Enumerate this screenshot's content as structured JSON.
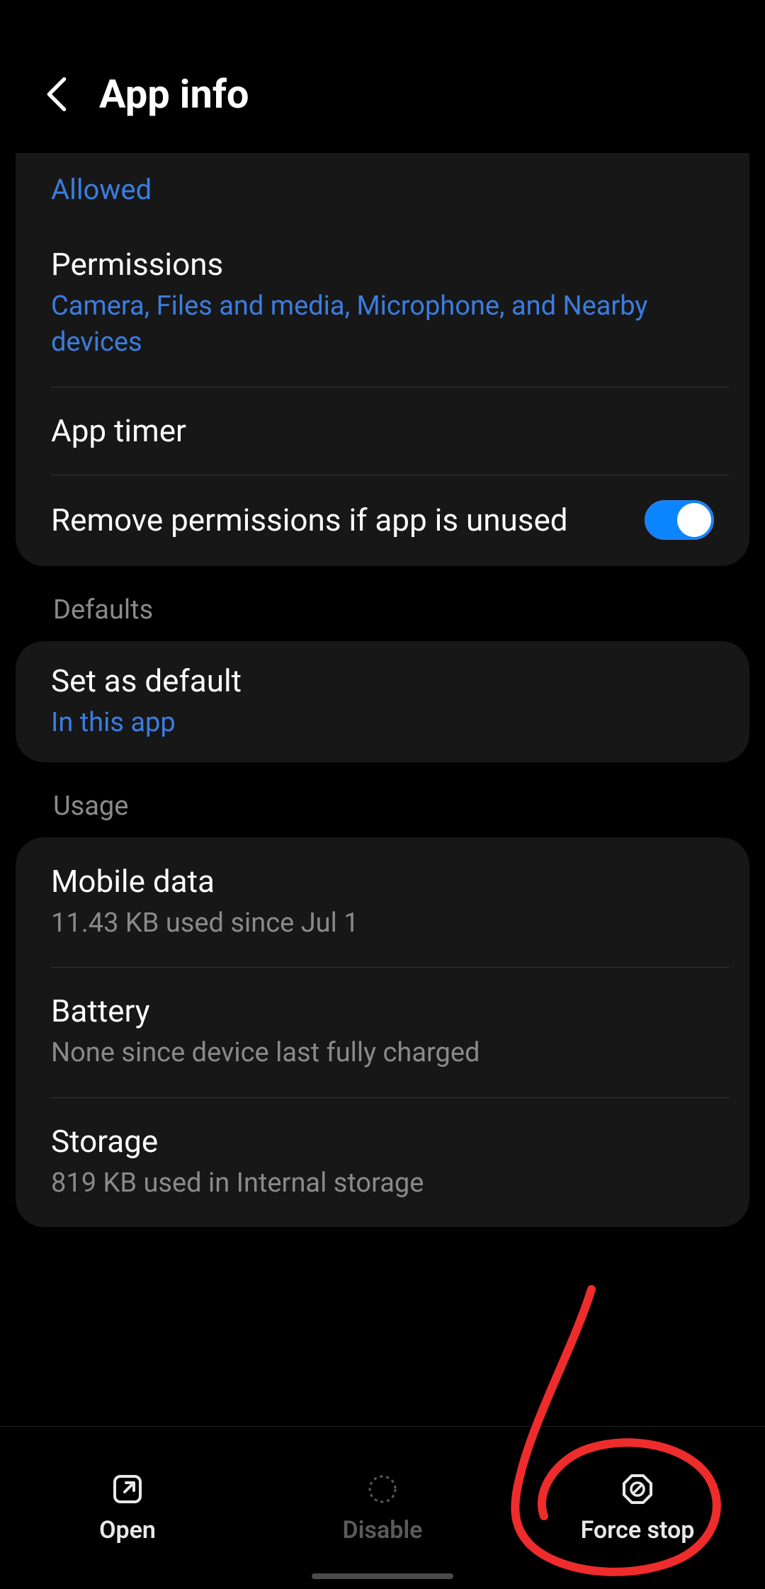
{
  "header": {
    "title": "App info"
  },
  "top_card": {
    "allowed_label": "Allowed",
    "permissions": {
      "title": "Permissions",
      "subtitle": "Camera, Files and media, Microphone, and Nearby devices"
    },
    "app_timer": {
      "title": "App timer"
    },
    "remove_permissions": {
      "title": "Remove permissions if app is unused",
      "enabled": true
    }
  },
  "defaults": {
    "header": "Defaults",
    "set_as_default": {
      "title": "Set as default",
      "subtitle": "In this app"
    }
  },
  "usage": {
    "header": "Usage",
    "mobile_data": {
      "title": "Mobile data",
      "subtitle": "11.43 KB used since Jul 1"
    },
    "battery": {
      "title": "Battery",
      "subtitle": "None since device last fully charged"
    },
    "storage": {
      "title": "Storage",
      "subtitle": "819 KB used in Internal storage"
    }
  },
  "bottom_bar": {
    "open": "Open",
    "disable": "Disable",
    "force_stop": "Force stop"
  },
  "annotation": {
    "color": "#ef2c2c"
  }
}
